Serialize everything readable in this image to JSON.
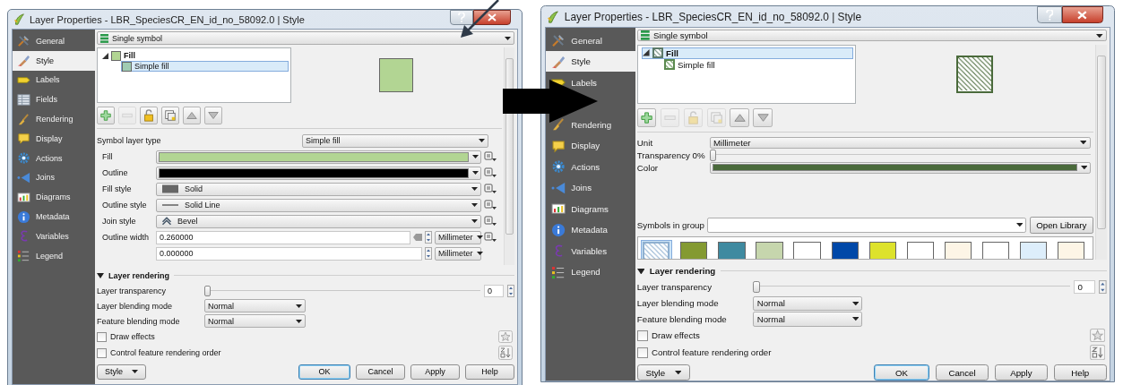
{
  "dialogs": [
    {
      "title": "Layer Properties - LBR_SpeciesCR_EN_id_no_58092.0 | Style",
      "sidebar": [
        {
          "label": "General",
          "selected": false
        },
        {
          "label": "Style",
          "selected": true
        },
        {
          "label": "Labels",
          "selected": false
        },
        {
          "label": "Fields",
          "selected": false
        },
        {
          "label": "Rendering",
          "selected": false
        },
        {
          "label": "Display",
          "selected": false
        },
        {
          "label": "Actions",
          "selected": false
        },
        {
          "label": "Joins",
          "selected": false
        },
        {
          "label": "Diagrams",
          "selected": false
        },
        {
          "label": "Metadata",
          "selected": false
        },
        {
          "label": "Variables",
          "selected": false
        },
        {
          "label": "Legend",
          "selected": false
        }
      ],
      "renderer": "Single symbol",
      "symbol_tree": [
        {
          "label": "Fill",
          "symbol": {
            "kind": "solid",
            "color": "#b2d593"
          },
          "expanded": true,
          "selected": false,
          "children": [
            {
              "label": "Simple fill",
              "symbol": {
                "kind": "solid",
                "color": "#9fcbb3"
              },
              "selected": true
            }
          ]
        }
      ],
      "preview": {
        "kind": "solid",
        "color": "#b2d593"
      },
      "layer_tools": [
        {
          "disabled": false
        },
        {
          "disabled": true
        },
        {
          "disabled": false
        },
        {
          "disabled": false
        },
        {
          "disabled": false
        },
        {
          "disabled": false
        }
      ],
      "properties": [
        {
          "kind": "typeselect",
          "label": "Symbol layer type",
          "value": "Simple fill",
          "data_defined": false
        },
        {
          "kind": "color",
          "label": "Fill",
          "color": "#b2d593",
          "data_defined": true
        },
        {
          "kind": "color",
          "label": "Outline",
          "color": "#000000",
          "data_defined": true
        },
        {
          "kind": "swatchselect",
          "label": "Fill style",
          "value": "Solid",
          "data_defined": true
        },
        {
          "kind": "lineselect",
          "label": "Outline style",
          "value": "Solid Line",
          "data_defined": true
        },
        {
          "kind": "joinselect",
          "label": "Join style",
          "value": "Bevel",
          "data_defined": true
        },
        {
          "kind": "number",
          "label": "Outline width",
          "value": "0.260000",
          "unit": "Millimeter",
          "data_defined": true
        },
        {
          "kind": "number",
          "value": "0.000000",
          "unit": "Millimeter",
          "data_defined": false
        }
      ],
      "layer_rendering": {
        "title": "Layer rendering",
        "expanded": true,
        "transparency": {
          "label": "Layer transparency",
          "level": 0,
          "value": "0"
        },
        "blending": [
          {
            "label": "Layer blending mode",
            "value": "Normal"
          },
          {
            "label": "Feature blending mode",
            "value": "Normal"
          }
        ],
        "options": [
          {
            "label": "Draw effects",
            "checked": false
          },
          {
            "label": "Control feature rendering order",
            "checked": false
          }
        ]
      },
      "buttons": [
        {
          "label": "Style",
          "menu": true,
          "default": false
        },
        {
          "label": "OK",
          "menu": false,
          "default": true
        },
        {
          "label": "Cancel",
          "menu": false,
          "default": false
        },
        {
          "label": "Apply",
          "menu": false,
          "default": false
        },
        {
          "label": "Help",
          "menu": false,
          "default": false
        }
      ]
    },
    {
      "title": "Layer Properties - LBR_SpeciesCR_EN_id_no_58092.0 | Style",
      "sidebar": [
        {
          "label": "General",
          "selected": false
        },
        {
          "label": "Style",
          "selected": true
        },
        {
          "label": "Labels",
          "selected": false
        },
        {
          "covered": true,
          "selected": false
        },
        {
          "label": "Rendering",
          "selected": false
        },
        {
          "label": "Display",
          "selected": false
        },
        {
          "label": "Actions",
          "selected": false
        },
        {
          "label": "Joins",
          "selected": false
        },
        {
          "label": "Diagrams",
          "selected": false
        },
        {
          "label": "Metadata",
          "selected": false
        },
        {
          "label": "Variables",
          "selected": false
        },
        {
          "label": "Legend",
          "selected": false
        }
      ],
      "renderer": "Single symbol",
      "symbol_tree": [
        {
          "label": "Fill",
          "symbol": {
            "kind": "hatch",
            "color": "#5b7a6a"
          },
          "expanded": true,
          "selected": true,
          "children": [
            {
              "label": "Simple fill",
              "symbol": {
                "kind": "hatch",
                "color": "#5b8a4f"
              },
              "selected": false
            }
          ]
        }
      ],
      "preview": {
        "kind": "hatch",
        "color": "#4a6a3b"
      },
      "layer_tools": [
        {
          "disabled": false
        },
        {
          "disabled": true
        },
        {
          "disabled": true
        },
        {
          "disabled": true
        },
        {
          "disabled": false
        },
        {
          "disabled": false
        }
      ],
      "properties": [
        {
          "kind": "select",
          "label": "Unit",
          "value": "Millimeter",
          "data_defined": false
        },
        {
          "kind": "slider",
          "label": "Transparency 0%",
          "level": 0,
          "data_defined": false
        },
        {
          "kind": "color",
          "label": "Color",
          "color": "#4a6a3b",
          "data_defined": false
        }
      ],
      "library": {
        "label": "Symbols in group",
        "button": "Open Library",
        "swatches": [
          {
            "kind": "hatch",
            "color": "#8fb0d0",
            "selected": true
          },
          {
            "kind": "solid",
            "color": "#849a32",
            "selected": false
          },
          {
            "kind": "solid",
            "color": "#3f8aa0",
            "selected": false
          },
          {
            "kind": "solid",
            "color": "#c6d6ad",
            "selected": false
          },
          {
            "kind": "solid",
            "color": "#ffffff",
            "selected": false
          },
          {
            "kind": "solid",
            "color": "#0048a8",
            "selected": false
          },
          {
            "kind": "solid",
            "color": "#dde22c",
            "selected": false
          },
          {
            "kind": "solid",
            "color": "#ffffff",
            "selected": false
          },
          {
            "kind": "solid",
            "color": "#fdf5e6",
            "selected": false
          },
          {
            "kind": "solid",
            "color": "#ffffff",
            "selected": false
          },
          {
            "kind": "solid",
            "color": "#ddeefb",
            "selected": false
          },
          {
            "kind": "solid",
            "color": "#fdf5e6",
            "selected": false
          }
        ]
      },
      "layer_rendering": {
        "title": "Layer rendering",
        "expanded": true,
        "transparency": {
          "label": "Layer transparency",
          "level": 0,
          "value": "0"
        },
        "blending": [
          {
            "label": "Layer blending mode",
            "value": "Normal"
          },
          {
            "label": "Feature blending mode",
            "value": "Normal"
          }
        ],
        "options": [
          {
            "label": "Draw effects",
            "checked": false
          },
          {
            "label": "Control feature rendering order",
            "checked": false
          }
        ]
      },
      "buttons": [
        {
          "label": "Style",
          "menu": true,
          "default": false
        },
        {
          "label": "OK",
          "menu": false,
          "default": true
        },
        {
          "label": "Cancel",
          "menu": false,
          "default": false
        },
        {
          "label": "Apply",
          "menu": false,
          "default": false
        },
        {
          "label": "Help",
          "menu": false,
          "default": false
        }
      ]
    }
  ]
}
